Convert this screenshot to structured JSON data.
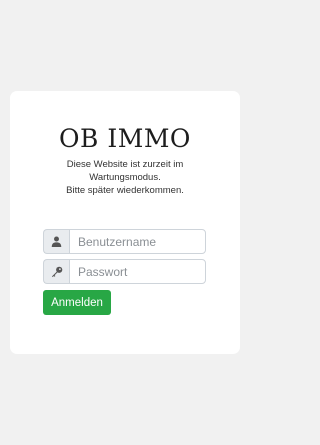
{
  "colors": {
    "page_bg": "#f1f1f1",
    "card_bg": "#ffffff",
    "button_bg": "#28a745",
    "addon_bg": "#e9ecef",
    "icon": "#555555"
  },
  "brand": {
    "title": "OB IMMO"
  },
  "message": {
    "line1": "Diese Website ist zurzeit im",
    "line2": "Wartungsmodus.",
    "line3": "Bitte später wiederkommen."
  },
  "login": {
    "username": {
      "icon": "user-icon",
      "placeholder": "Benutzername",
      "value": ""
    },
    "password": {
      "icon": "key-icon",
      "placeholder": "Passwort",
      "value": ""
    },
    "submit_label": "Anmelden"
  }
}
